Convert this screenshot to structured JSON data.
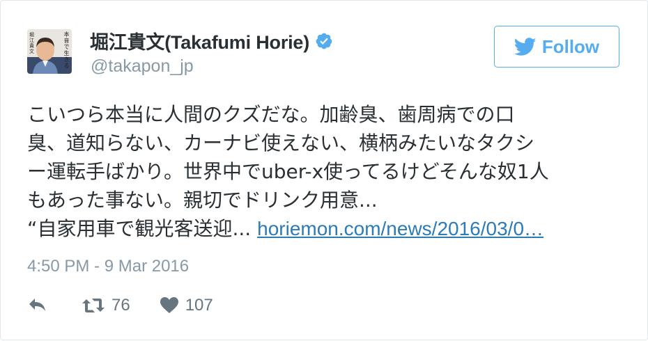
{
  "user": {
    "display_name": "堀江貴文(Takafumi Horie)",
    "handle": "@takapon_jp",
    "verified": true,
    "avatar_book_title": "本音で生きる",
    "avatar_author": "堀江貴文"
  },
  "follow_button": {
    "label": "Follow"
  },
  "tweet": {
    "lines": [
      "こいつら本当に人間のクズだな。加齢臭、歯周病での口",
      "臭、道知らない、カーナビ使えない、横柄みたいなタクシ",
      "ー運転手ばかり。世界中でuber-x使ってるけどそんな奴1人",
      "もあった事ない。親切でドリンク用意...",
      "“自家用車で観光客送迎..."
    ],
    "link_text": "horiemon.com/news/2016/03/0…",
    "timestamp": "4:50 PM - 9 Mar 2016"
  },
  "actions": {
    "reply_icon": "reply-icon",
    "retweet_icon": "retweet-icon",
    "retweet_count": "76",
    "like_icon": "heart-icon",
    "like_count": "107"
  },
  "colors": {
    "twitter_blue": "#55acee",
    "link": "#2b7bb9",
    "muted": "#8899a6",
    "text": "#292f33"
  }
}
